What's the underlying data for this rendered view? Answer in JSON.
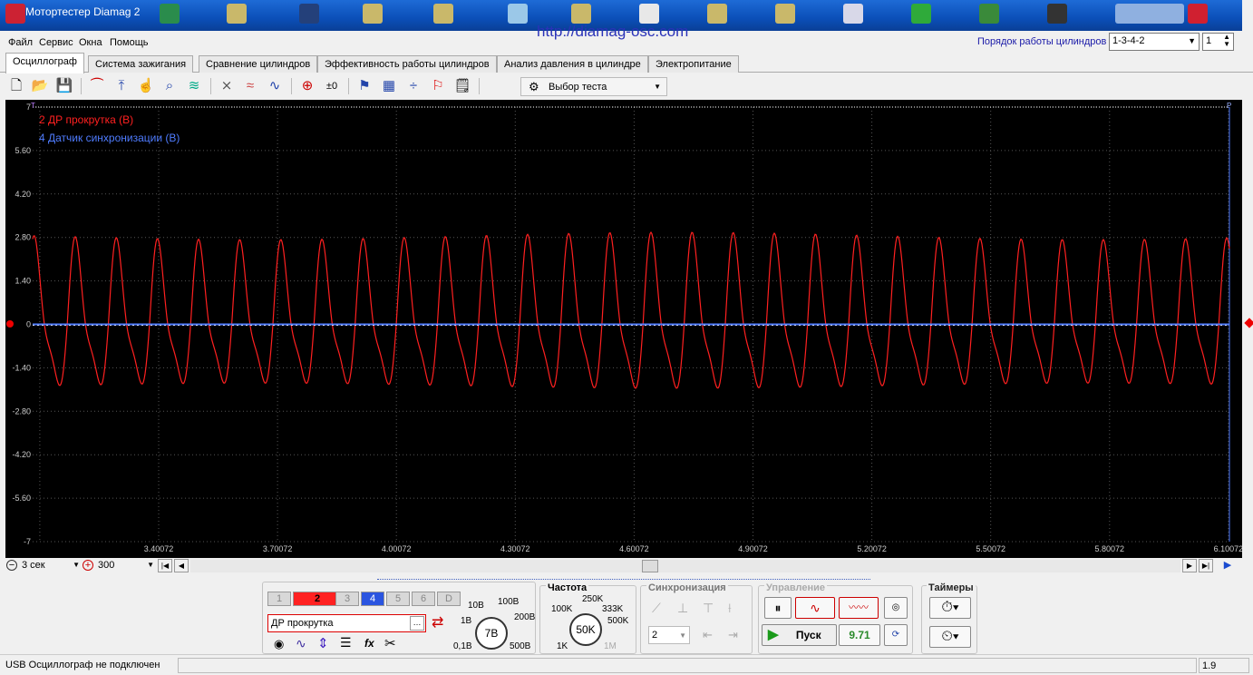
{
  "taskbar": {
    "title": "Мотортестер Diamag 2"
  },
  "url": "http://diamag-osc.com",
  "menu": [
    "Файл",
    "Сервис",
    "Окна",
    "Помощь"
  ],
  "cylinders": {
    "label": "Порядок работы цилиндров",
    "order": "1-3-4-2",
    "count": "1"
  },
  "tabs": [
    "Осциллограф",
    "Система зажигания",
    "Сравнение цилиндров",
    "Эффективность работы цилиндров",
    "Анализ давления в цилиндре",
    "Электропитание"
  ],
  "toolbar": {
    "test_select": "Выбор теста"
  },
  "scope": {
    "legend": [
      {
        "label": "2 ДР прокрутка (В)",
        "color": "#ff2020"
      },
      {
        "label": "4 Датчик синхронизации (В)",
        "color": "#4f7cff"
      }
    ],
    "y_ticks": [
      "7",
      "5.60",
      "4.20",
      "2.80",
      "1.40",
      "0",
      "-1.40",
      "-2.80",
      "-4.20",
      "-5.60",
      "-7"
    ],
    "x_ticks": [
      "3.40072",
      "3.70072",
      "4.00072",
      "4.30072",
      "4.60072",
      "4.90072",
      "5.20072",
      "5.50072",
      "5.80072",
      "6.10072"
    ],
    "top_marker_left": "T",
    "top_marker_right": "P"
  },
  "chart_data": {
    "type": "line",
    "ylim": [
      -7,
      7
    ],
    "xlim": [
      3.1007,
      6.1007
    ],
    "series": [
      {
        "name": "2 ДР прокрутка (В)",
        "color": "#ff2020",
        "peaks_per_sec": 9.7,
        "amplitude_hi": 2.8,
        "amplitude_lo": -2.4
      },
      {
        "name": "4 Датчик синхронизации (В)",
        "color": "#4f7cff",
        "values": [
          0,
          0
        ]
      }
    ]
  },
  "timebase": {
    "value": "3 сек",
    "points": "300"
  },
  "channels": {
    "buttons": [
      "1",
      "2",
      "3",
      "4",
      "5",
      "6",
      "D"
    ],
    "name": "ДР прокрутка",
    "volt_labels": [
      "10В",
      "100В",
      "1В",
      "200В",
      "0,1В",
      "500В"
    ],
    "volt_value": "7В"
  },
  "freq": {
    "title": "Частота",
    "labels": [
      "250K",
      "100K",
      "333K",
      "500K",
      "1K",
      "1M"
    ],
    "value": "50K"
  },
  "sync": {
    "title": "Синхронизация",
    "value": "2"
  },
  "control": {
    "title": "Управление",
    "start": "Пуск",
    "rate": "9.71"
  },
  "timers": {
    "title": "Таймеры"
  },
  "status": {
    "text": "USB Осциллограф не подключен",
    "version": "1.9"
  }
}
